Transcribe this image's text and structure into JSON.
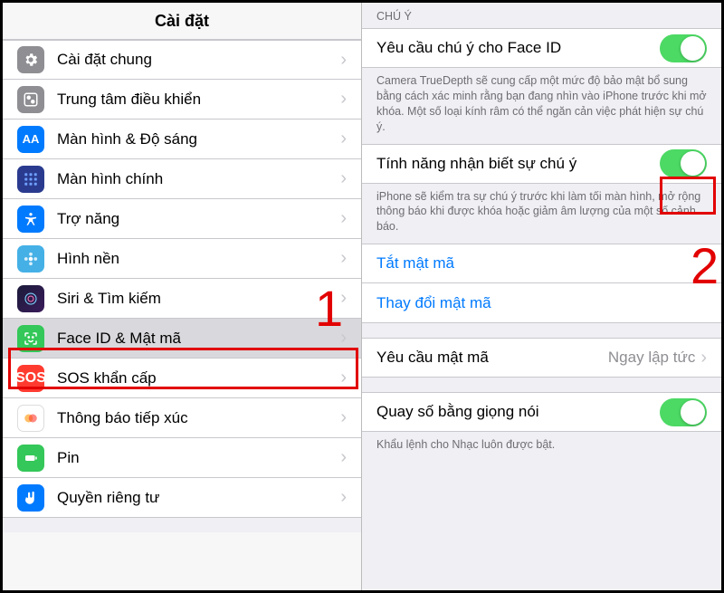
{
  "left": {
    "title": "Cài đặt",
    "items": [
      {
        "icon": "gear",
        "label": "Cài đặt chung"
      },
      {
        "icon": "control",
        "label": "Trung tâm điều khiển"
      },
      {
        "icon": "display",
        "label": "Màn hình & Độ sáng"
      },
      {
        "icon": "home",
        "label": "Màn hình chính"
      },
      {
        "icon": "access",
        "label": "Trợ năng"
      },
      {
        "icon": "wallpaper",
        "label": "Hình nền"
      },
      {
        "icon": "siri",
        "label": "Siri & Tìm kiếm"
      },
      {
        "icon": "faceid",
        "label": "Face ID & Mật mã"
      },
      {
        "icon": "sos",
        "label": "SOS khẩn cấp"
      },
      {
        "icon": "exposure",
        "label": "Thông báo tiếp xúc"
      },
      {
        "icon": "battery",
        "label": "Pin"
      },
      {
        "icon": "privacy",
        "label": "Quyền riêng tư"
      }
    ]
  },
  "right": {
    "section_header": "CHÚ Ý",
    "attention_faceid": {
      "label": "Yêu cầu chú ý cho Face ID",
      "on": true
    },
    "attention_faceid_footer": "Camera TrueDepth sẽ cung cấp một mức độ bảo mật bổ sung bằng cách xác minh rằng bạn đang nhìn vào iPhone trước khi mở khóa. Một số loại kính râm có thể ngăn cản việc phát hiện sự chú ý.",
    "attention_aware": {
      "label": "Tính năng nhận biết sự chú ý",
      "on": true
    },
    "attention_aware_footer": "iPhone sẽ kiểm tra sự chú ý trước khi làm tối màn hình, mở rộng thông báo khi được khóa hoặc giảm âm lượng của một số cảnh báo.",
    "turn_off": "Tắt mật mã",
    "change": "Thay đổi mật mã",
    "require": {
      "label": "Yêu cầu mật mã",
      "value": "Ngay lập tức"
    },
    "voice_dial": {
      "label": "Quay số bằng giọng nói",
      "on": true
    },
    "voice_dial_footer": "Khẩu lệnh cho Nhạc luôn được bật."
  },
  "annotations": {
    "one": "1",
    "two": "2"
  }
}
